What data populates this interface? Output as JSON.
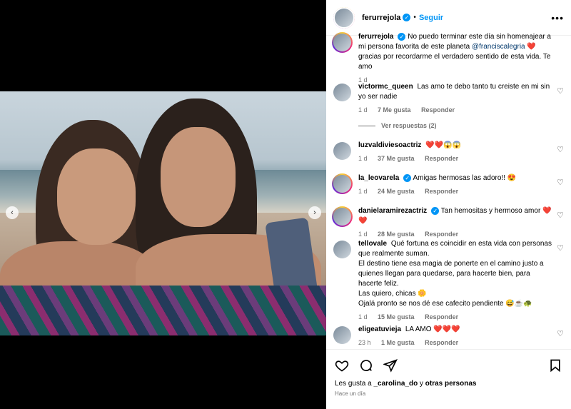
{
  "post": {
    "author": "ferurrejola",
    "follow_label": "Seguir",
    "dot": "•",
    "more": "•••"
  },
  "caption": {
    "username": "ferurrejola",
    "text_before": "No puedo terminar este día sin homenajear a mi persona favorita de este planeta ",
    "mention": "@franciscalegria",
    "text_after": " ❤️ gracias por recordarme el verdadero sentido de esta vida. Te amo",
    "time": "1 d"
  },
  "comments": [
    {
      "username": "victormc_queen",
      "text": "Las amo te debo tanto tu creiste en mi sin yo ser nadie",
      "time": "1 d",
      "likes": "7 Me gusta",
      "reply": "Responder",
      "view_replies": "Ver respuestas (2)"
    },
    {
      "username": "luzvaldiviesoactriz",
      "text": "❤️❤️😱😱",
      "time": "1 d",
      "likes": "37 Me gusta",
      "reply": "Responder"
    },
    {
      "username": "la_leovarela",
      "text": "Amigas hermosas las adoro!! 😍",
      "time": "1 d",
      "likes": "24 Me gusta",
      "reply": "Responder"
    },
    {
      "username": "danielaramirezactriz",
      "text": "Tan hemositas y hermoso amor ❤️❤️",
      "time": "1 d",
      "likes": "28 Me gusta",
      "reply": "Responder"
    },
    {
      "username": "tellovale",
      "text_lines": [
        "Qué fortuna es coincidir en esta vida con personas que realmente suman.",
        "El destino tiene esa magia de ponerte en el camino justo a quienes llegan para quedarse, para hacerte bien, para hacerte feliz.",
        "Las quiero, chicas 🌼",
        "Ojalá pronto se nos dé ese cafecito pendiente 😅☕🐢"
      ],
      "time": "1 d",
      "likes": "15 Me gusta",
      "reply": "Responder"
    },
    {
      "username": "eligeatuvieja",
      "text": "LA AMO ❤️❤️❤️",
      "time": "23 h",
      "likes": "1 Me gusta",
      "reply": "Responder"
    }
  ],
  "footer": {
    "likes_prefix": "Les gusta a ",
    "likes_user": "_carolina_do",
    "likes_mid": " y ",
    "likes_others": "otras personas",
    "time": "Hace un día"
  },
  "icons": {
    "prev": "‹",
    "next": "›",
    "heart": "♡",
    "verified": "✓"
  }
}
